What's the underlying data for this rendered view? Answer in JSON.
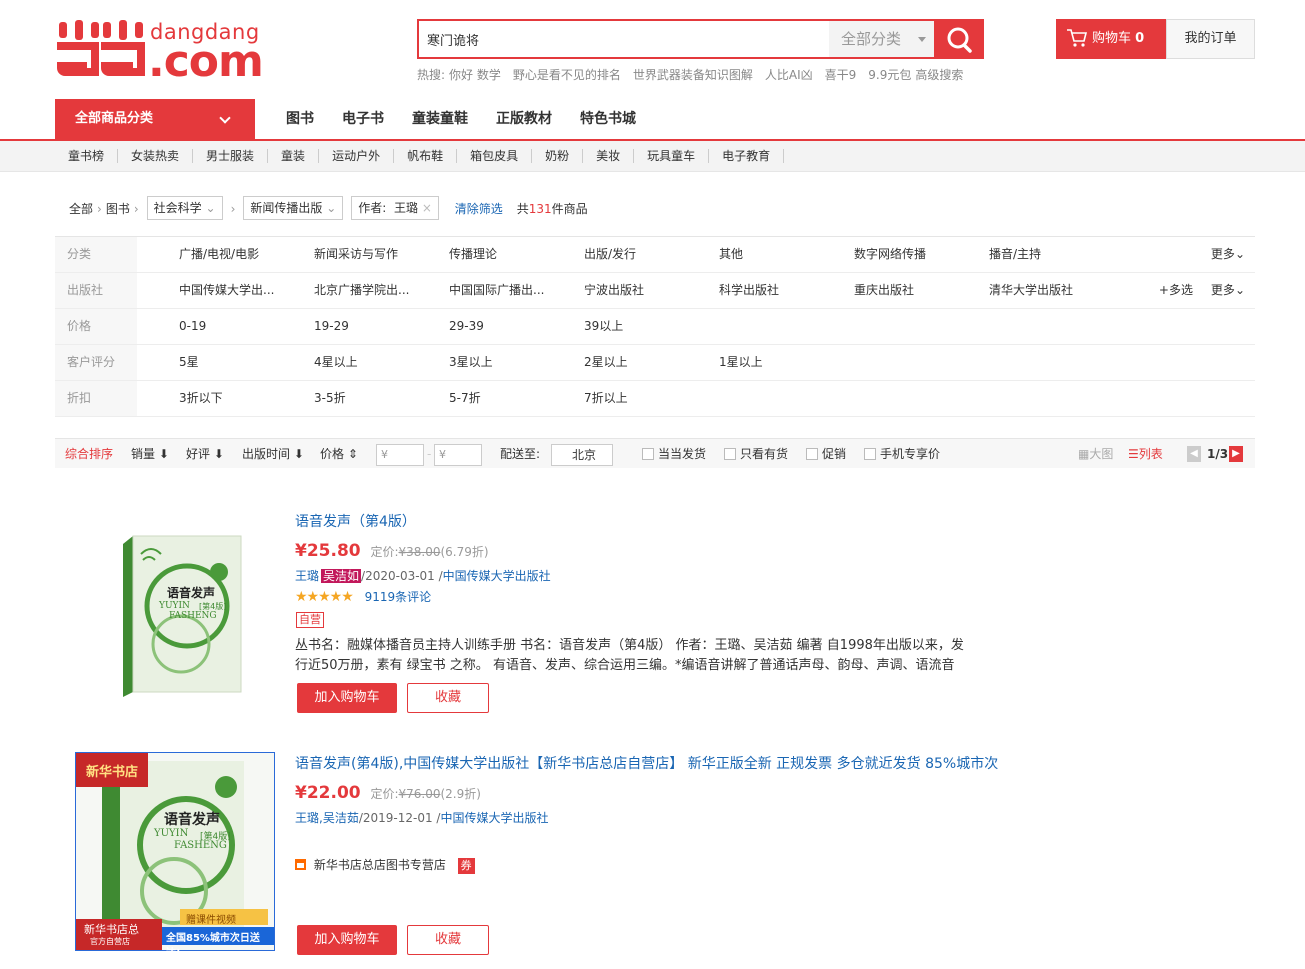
{
  "header": {
    "logo_text_top": "dangdang",
    "logo_text_bottom": ".com",
    "search_value": "寒门诡将",
    "search_category": "全部分类",
    "hot_label": "热搜:",
    "hot_terms": [
      "你好 数学",
      "野心是看不见的排名",
      "世界武器装备知识图解",
      "人比AI凶",
      "喜干9",
      "9.9元包",
      "高级搜索"
    ],
    "cart_label": "购物车",
    "cart_count": "0",
    "orders_label": "我的订单"
  },
  "nav": {
    "all_categories": "全部商品分类",
    "main": [
      "图书",
      "电子书",
      "童装童鞋",
      "正版教材",
      "特色书城"
    ],
    "sub": [
      "童书榜",
      "女装热卖",
      "男士服装",
      "童装",
      "运动户外",
      "帆布鞋",
      "箱包皮具",
      "奶粉",
      "美妆",
      "玩具童车",
      "电子教育"
    ]
  },
  "breadcrumb": {
    "all": "全部",
    "books": "图书",
    "social": "社会科学",
    "journalism": "新闻传播出版",
    "author_label": "作者:",
    "author_value": "王璐",
    "clear": "清除筛选",
    "count_prefix": "共",
    "count": "131",
    "count_suffix": "件商品"
  },
  "filters": {
    "category": {
      "label": "分类",
      "options": [
        "广播/电视/电影",
        "新闻采访与写作",
        "传播理论",
        "出版/发行",
        "其他",
        "数字网络传播",
        "播音/主持"
      ],
      "more": "更多"
    },
    "publisher": {
      "label": "出版社",
      "options": [
        "中国传媒大学出...",
        "北京广播学院出...",
        "中国国际广播出...",
        "宁波出版社",
        "科学出版社",
        "重庆出版社",
        "清华大学出版社"
      ],
      "multi": "多选",
      "more": "更多"
    },
    "price": {
      "label": "价格",
      "options": [
        "0-19",
        "19-29",
        "29-39",
        "39以上"
      ]
    },
    "rating": {
      "label": "客户评分",
      "options": [
        "5星",
        "4星以上",
        "3星以上",
        "2星以上",
        "1星以上"
      ]
    },
    "discount": {
      "label": "折扣",
      "options": [
        "3折以下",
        "3-5折",
        "5-7折",
        "7折以上"
      ]
    }
  },
  "sortbar": {
    "overall": "综合排序",
    "sales": "销量",
    "reviews": "好评",
    "pubdate": "出版时间",
    "price": "价格",
    "price_from": "¥",
    "price_to": "¥",
    "ship_label": "配送至:",
    "ship_city": "北京",
    "dangdang_ship": "当当发货",
    "in_stock": "只看有货",
    "promo": "促销",
    "mobile": "手机专享价",
    "grid_view": "大图",
    "list_view": "列表",
    "page": "1/3"
  },
  "products": [
    {
      "title": "语音发声（第4版）",
      "price": "¥25.80",
      "orig_label": "定价:",
      "orig_price": "¥38.00",
      "discount": "(6.79折)",
      "author1": "王璐",
      "author2": "吴洁如",
      "date_pub": "/2020-03-01 /",
      "publisher": "中国传媒大学出版社",
      "reviews": "9119条评论",
      "rating": 5,
      "tag": "自营",
      "desc_line1": "丛书名：融媒体播音员主持人训练手册 书名：语音发声（第4版） 作者：王璐、吴洁茹 编著 自1998年出版以来，发",
      "desc_line2": "行近50万册，素有 绿宝书 之称。 有语音、发声、综合运用三编。*编语音讲解了普通话声母、韵母、声调、语流音",
      "cart_btn": "加入购物车",
      "fav_btn": "收藏",
      "cover_title": "语音发声",
      "cover_pinyin1": "YUYIN",
      "cover_pinyin2": "FASHENG",
      "cover_edition": "[第4版]"
    },
    {
      "title": "语音发声(第4版),中国传媒大学出版社【新华书店总店自营店】 新华正版全新 正规发票 多仓就近发货 85%城市次",
      "price": "¥22.00",
      "orig_label": "定价:",
      "orig_price": "¥76.00",
      "discount": "(2.9折)",
      "authors": "王璐,吴洁茹",
      "date_pub": "/2019-12-01 /",
      "publisher": "中国传媒大学出版社",
      "shop": "新华书店总店图书专营店",
      "coupon": "券",
      "cart_btn": "加入购物车",
      "fav_btn": "收藏",
      "cover_title": "语音发声",
      "cover_pinyin1": "YUYIN",
      "cover_pinyin2": "FASHENG",
      "cover_edition": "[第4版]",
      "cover_top": "新华书店",
      "cover_badge1": "新华书店总",
      "cover_badge2": "官方自营店",
      "cover_banner": "全国85%城市次日送达!",
      "cover_sticker": "赠课件视频"
    }
  ],
  "colors": {
    "brand": "#e4393c",
    "link": "#1a66b3",
    "cover_green": "#4a9a3a"
  }
}
